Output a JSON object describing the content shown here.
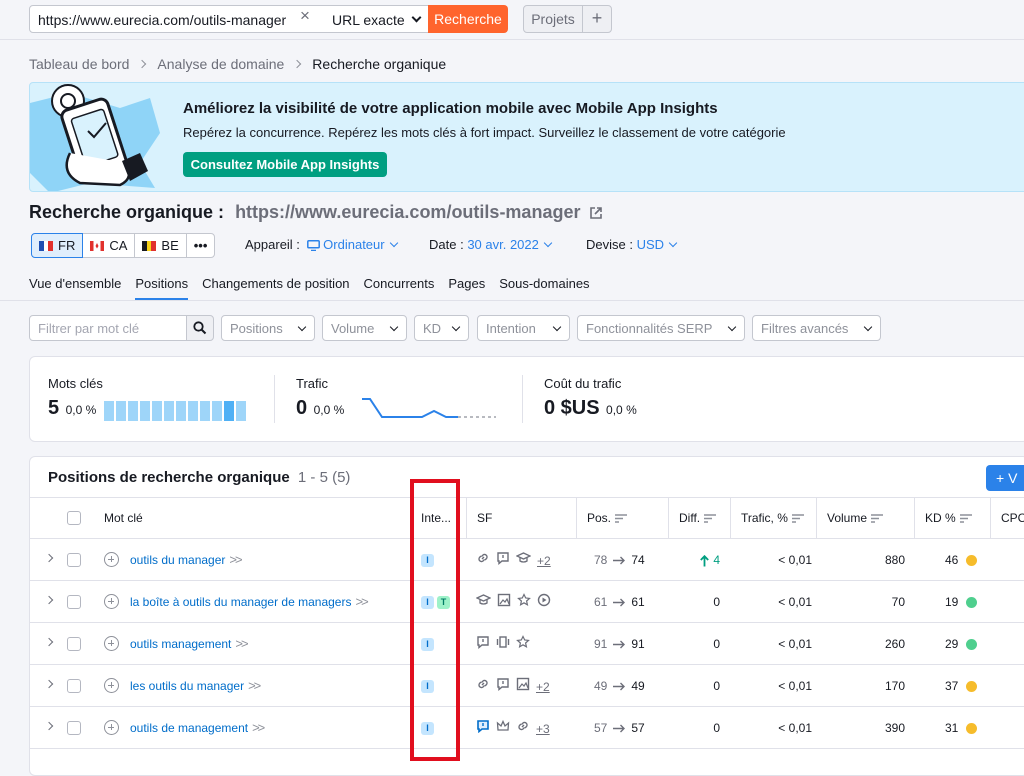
{
  "topbar": {
    "url_value": "https://www.eurecia.com/outils-manager",
    "clear_icon": "×",
    "match_type": "URL exacte",
    "search_label": "Recherche",
    "projects_label": "Projets",
    "plus_label": "+"
  },
  "breadcrumb": {
    "items": [
      "Tableau de bord",
      "Analyse de domaine",
      "Recherche organique"
    ]
  },
  "banner": {
    "title": "Améliorez la visibilité de votre application mobile avec Mobile App Insights",
    "subtitle": "Repérez la concurrence. Repérez les mots clés à fort impact. Surveillez le classement de votre catégorie",
    "cta": "Consultez Mobile App Insights"
  },
  "page": {
    "title": "Recherche organique :",
    "url": "https://www.eurecia.com/outils-manager"
  },
  "databases": [
    {
      "code": "FR",
      "flag": "fr-flag",
      "active": true
    },
    {
      "code": "CA",
      "flag": "ca-flag",
      "active": false
    },
    {
      "code": "BE",
      "flag": "be-flag",
      "active": false
    }
  ],
  "more_label": "•••",
  "controls": {
    "device_label": "Appareil :",
    "device_value": "Ordinateur",
    "date_label": "Date :",
    "date_value": "30 avr. 2022",
    "currency_label": "Devise :",
    "currency_value": "USD"
  },
  "tabs": [
    "Vue d'ensemble",
    "Positions",
    "Changements de position",
    "Concurrents",
    "Pages",
    "Sous-domaines"
  ],
  "active_tab": "Positions",
  "filters": {
    "keyword_placeholder": "Filtrer par mot clé",
    "dropdowns": [
      "Positions",
      "Volume",
      "KD",
      "Intention",
      "Fonctionnalités SERP",
      "Filtres avancés"
    ]
  },
  "summary": {
    "keywords": {
      "label": "Mots clés",
      "value": "5",
      "change": "0,0 %"
    },
    "traffic": {
      "label": "Trafic",
      "value": "0",
      "change": "0,0 %"
    },
    "cost": {
      "label": "Coût du trafic",
      "value": "0 $US",
      "change": "0,0 %"
    }
  },
  "table": {
    "title": "Positions de recherche organique",
    "range": "1 - 5 (5)",
    "add_label": "+ V",
    "headers": {
      "keyword": "Mot clé",
      "intent": "Inte...",
      "sf": "SF",
      "pos": "Pos.",
      "diff": "Diff.",
      "traffic": "Trafic, %",
      "volume": "Volume",
      "kd": "KD %",
      "cpc": "CPC"
    },
    "rows": [
      {
        "keyword": "outils du manager",
        "intents": [
          "I"
        ],
        "sf": [
          "link-icon",
          "review-icon",
          "graduation-cap-icon"
        ],
        "sf_more": "+2",
        "pos_from": "78",
        "pos_to": "74",
        "diff": "4",
        "diff_up": true,
        "traffic": "< 0,01",
        "volume": "880",
        "kd": "46",
        "kd_color": "#f6bc2b"
      },
      {
        "keyword": "la boîte à outils du manager de managers",
        "intents": [
          "I",
          "T"
        ],
        "sf": [
          "graduation-cap-icon",
          "image-icon",
          "star-icon",
          "video-icon"
        ],
        "sf_more": "",
        "pos_from": "61",
        "pos_to": "61",
        "diff": "0",
        "diff_up": false,
        "traffic": "< 0,01",
        "volume": "70",
        "kd": "19",
        "kd_color": "#4fcf8e"
      },
      {
        "keyword": "outils management",
        "intents": [
          "I"
        ],
        "sf": [
          "review-icon",
          "carousel-icon",
          "star-icon"
        ],
        "sf_more": "",
        "pos_from": "91",
        "pos_to": "91",
        "diff": "0",
        "diff_up": false,
        "traffic": "< 0,01",
        "volume": "260",
        "kd": "29",
        "kd_color": "#4fcf8e"
      },
      {
        "keyword": "les outils du manager",
        "intents": [
          "I"
        ],
        "sf": [
          "link-icon",
          "review-icon",
          "image-icon"
        ],
        "sf_more": "+2",
        "pos_from": "49",
        "pos_to": "49",
        "diff": "0",
        "diff_up": false,
        "traffic": "< 0,01",
        "volume": "170",
        "kd": "37",
        "kd_color": "#f6bc2b"
      },
      {
        "keyword": "outils de management",
        "intents": [
          "I"
        ],
        "sf": [
          "review-blue-icon",
          "crown-icon",
          "link-icon"
        ],
        "sf_more": "+3",
        "pos_from": "57",
        "pos_to": "57",
        "diff": "0",
        "diff_up": false,
        "traffic": "< 0,01",
        "volume": "390",
        "kd": "31",
        "kd_color": "#f6bc2b"
      }
    ]
  },
  "colors": {
    "accent_orange": "#ff642d",
    "accent_blue": "#2b82e9",
    "cta_green": "#009f81",
    "highlight_red": "#e10e1e"
  }
}
